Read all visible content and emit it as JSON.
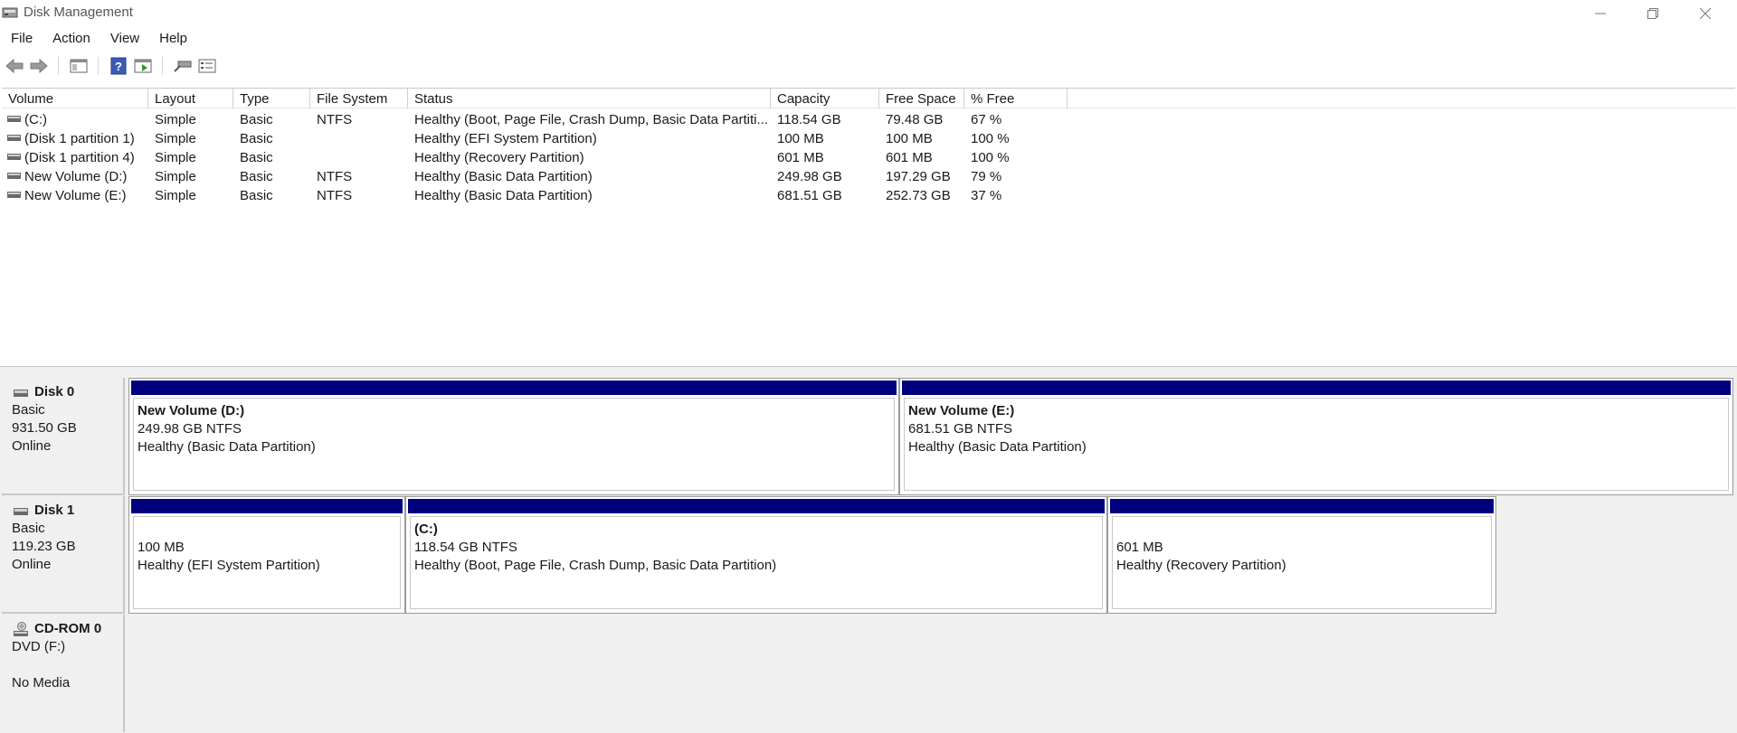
{
  "window": {
    "title": "Disk Management",
    "controls": [
      "minimize-icon",
      "restore-icon",
      "close-icon"
    ]
  },
  "menu": [
    "File",
    "Action",
    "View",
    "Help"
  ],
  "toolbar": [
    "back-arrow-icon",
    "forward-arrow-icon",
    "show-hide-console-tree-icon",
    "help-icon",
    "properties-icon",
    "rescan-disks-icon",
    "settings-list-icon"
  ],
  "volume_list": {
    "columns": [
      "Volume",
      "Layout",
      "Type",
      "File System",
      "Status",
      "Capacity",
      "Free Space",
      "% Free"
    ],
    "rows": [
      {
        "volume": " (C:)",
        "layout": "Simple",
        "type": "Basic",
        "fs": "NTFS",
        "status": "Healthy (Boot, Page File, Crash Dump, Basic Data Partiti...",
        "capacity": "118.54 GB",
        "free": "79.48 GB",
        "pct": "67 %"
      },
      {
        "volume": "(Disk 1 partition 1)",
        "layout": "Simple",
        "type": "Basic",
        "fs": "",
        "status": "Healthy (EFI System Partition)",
        "capacity": "100 MB",
        "free": "100 MB",
        "pct": "100 %"
      },
      {
        "volume": "(Disk 1 partition 4)",
        "layout": "Simple",
        "type": "Basic",
        "fs": "",
        "status": "Healthy (Recovery Partition)",
        "capacity": "601 MB",
        "free": "601 MB",
        "pct": "100 %"
      },
      {
        "volume": "New Volume (D:)",
        "layout": "Simple",
        "type": "Basic",
        "fs": "NTFS",
        "status": "Healthy (Basic Data Partition)",
        "capacity": "249.98 GB",
        "free": "197.29 GB",
        "pct": "79 %"
      },
      {
        "volume": "New Volume (E:)",
        "layout": "Simple",
        "type": "Basic",
        "fs": "NTFS",
        "status": "Healthy (Basic Data Partition)",
        "capacity": "681.51 GB",
        "free": "252.73 GB",
        "pct": "37 %"
      }
    ]
  },
  "disks": [
    {
      "name": "Disk 0",
      "type": "Basic",
      "size": "931.50 GB",
      "state": "Online",
      "partitions": [
        {
          "name": "New Volume  (D:)",
          "size": "249.98 GB NTFS",
          "status": "Healthy (Basic Data Partition)"
        },
        {
          "name": "New Volume  (E:)",
          "size": "681.51 GB NTFS",
          "status": "Healthy (Basic Data Partition)"
        }
      ]
    },
    {
      "name": "Disk 1",
      "type": "Basic",
      "size": "119.23 GB",
      "state": "Online",
      "partitions": [
        {
          "name": "",
          "size": "100 MB",
          "status": "Healthy (EFI System Partition)"
        },
        {
          "name": " (C:)",
          "size": "118.54 GB NTFS",
          "status": "Healthy (Boot, Page File, Crash Dump, Basic Data Partition)"
        },
        {
          "name": "",
          "size": "601 MB",
          "status": "Healthy (Recovery Partition)"
        }
      ]
    },
    {
      "name": "CD-ROM 0",
      "type": "DVD (F:)",
      "size": "",
      "state": "No Media",
      "partitions": []
    }
  ],
  "colors": {
    "partition_bar": "#00007e",
    "background": "#f0f0f0"
  }
}
